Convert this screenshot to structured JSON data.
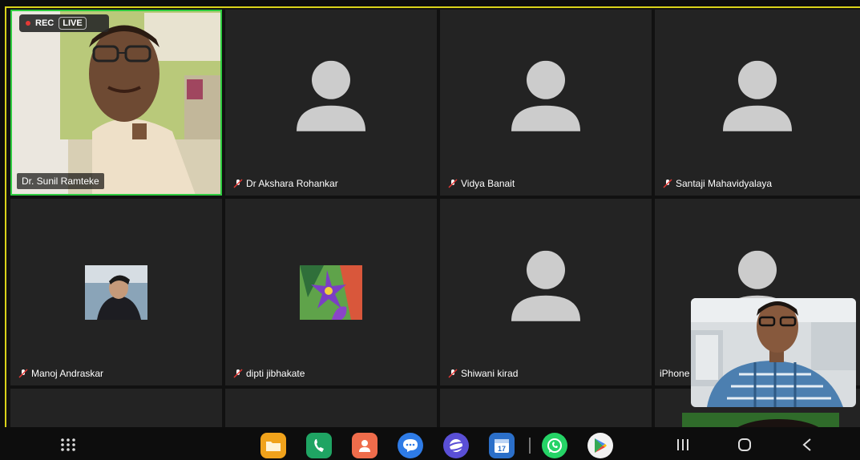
{
  "recording": {
    "rec_label": "REC",
    "live_label": "LIVE"
  },
  "participants": [
    {
      "name": "Dr. Sunil Ramteke",
      "type": "video"
    },
    {
      "name": "Dr Akshara Rohankar",
      "type": "avatar"
    },
    {
      "name": "Vidya Banait",
      "type": "avatar"
    },
    {
      "name": "Santaji Mahavidyalaya",
      "type": "avatar"
    },
    {
      "name": "Manoj Andraskar",
      "type": "photo"
    },
    {
      "name": "dipti jibhakate",
      "type": "photo"
    },
    {
      "name": "Shiwani kirad",
      "type": "avatar"
    },
    {
      "name": "iPhone",
      "type": "avatar"
    }
  ],
  "icons": {
    "muted": "mic-off-icon",
    "apps": [
      "files-icon",
      "phone-icon",
      "contacts-icon",
      "messages-icon",
      "internet-icon",
      "calendar-icon",
      "whatsapp-icon",
      "play-store-icon"
    ],
    "nav": [
      "app-drawer-icon",
      "recents-icon",
      "home-icon",
      "back-icon"
    ]
  },
  "calendar_day": "17",
  "colors": {
    "active_speaker": "#2ecc40",
    "frame": "#d9d21a",
    "tile": "#232323"
  }
}
